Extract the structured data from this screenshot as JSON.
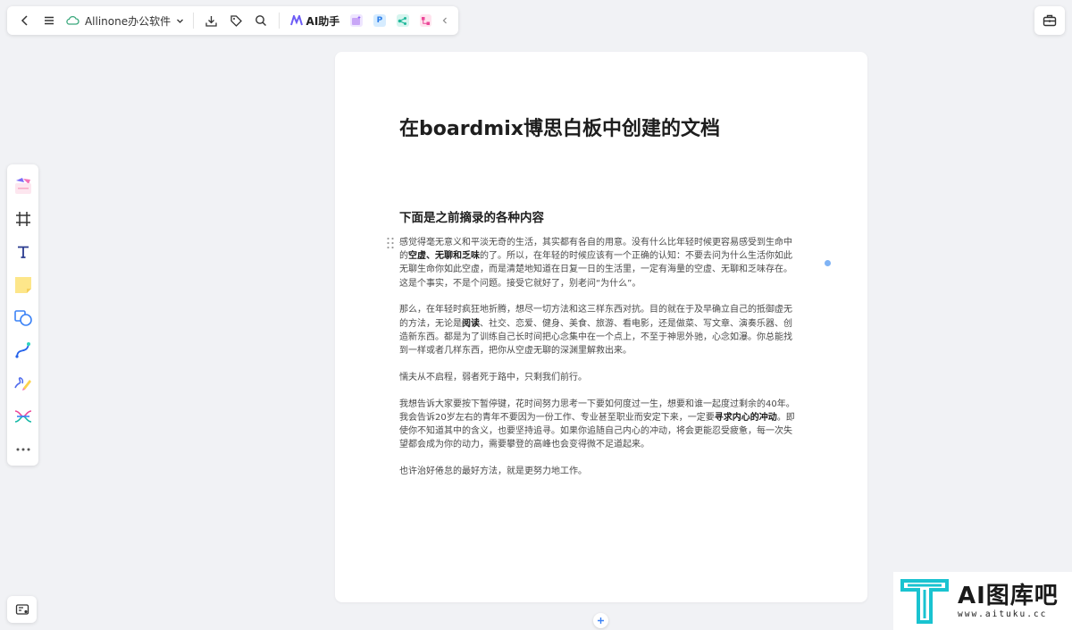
{
  "topbar": {
    "file_name": "Allinone办公软件",
    "ai_label": "AI助手",
    "tool_p_label": "P"
  },
  "document": {
    "title": "在boardmix博思白板中创建的文档",
    "heading": "下面是之前摘录的各种内容",
    "p1_a": "感觉得毫无意义和平淡无奇的生活，其实都有各自的用意。没有什么比年轻时候更容易感受到生命中的",
    "p1_b1": "空虚、无聊和乏味",
    "p1_c": "的了。所以，在年轻的时候应该有一个正确的认知：不要去问为什么生活你如此无聊生命你如此空虚，而是清楚地知道在日复一日的生活里，一定有海量的空虚、无聊和乏味存在。这是个事实，不是个问题。接受它就好了，别老问“为什么”。",
    "p2_a": "那么，在年轻时疯狂地折腾，想尽一切方法和这三样东西对抗。目的就在于及早确立自己的抵御虚无的方法，无论是",
    "p2_b1": "阅读",
    "p2_c": "、社交、恋爱、健身、美食、旅游、看电影，还是做菜、写文章、演奏乐器、创造新东西。都是为了训练自己长时间把心念集中在一个点上，不至于神思外驰，心念如瀑。你总能找到一样或者几样东西，把你从空虚无聊的深渊里解救出来。",
    "p3": "懦夫从不启程，弱者死于路中，只剩我们前行。",
    "p4_a": "我想告诉大家要按下暂停键，花时间努力思考一下要如何度过一生，想要和谁一起度过剩余的40年。我会告诉20岁左右的青年不要因为一份工作、专业甚至职业而安定下来，一定要",
    "p4_b1": "寻求内心的冲动",
    "p4_c": "。即使你不知道其中的含义，也要坚持追寻。如果你追随自己内心的冲动，将会更能忍受疲惫，每一次失望都会成为你的动力，需要攀登的高峰也会变得微不足道起来。",
    "p5": "也许治好倦怠的最好方法，就是更努力地工作。"
  },
  "watermark": {
    "title": "AI图库吧",
    "url": "www.aituku.cc"
  },
  "colors": {
    "accent": "#3b82f6",
    "brand_teal": "#19c3d0"
  }
}
